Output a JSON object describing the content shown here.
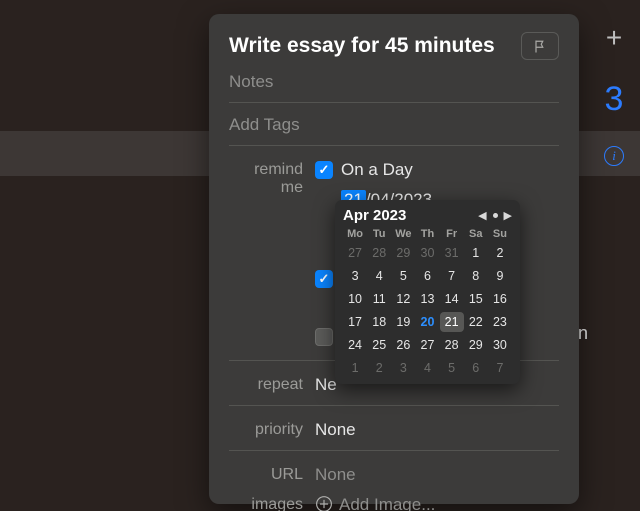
{
  "sidebar": {
    "big_number": "3",
    "background_item_suffix": "son"
  },
  "panel": {
    "title": "Write essay for 45 minutes",
    "notes_placeholder": "Notes",
    "tags_placeholder": "Add Tags",
    "labels": {
      "remind_me": "remind me",
      "repeat": "repeat",
      "priority": "priority",
      "url": "URL",
      "images": "images"
    },
    "remind": {
      "on_a_day_label": "On a Day",
      "date": {
        "selected_part": "21",
        "rest": "/04/2023"
      }
    },
    "repeat_value_visible": "Ne",
    "priority_value": "None",
    "url_value": "None",
    "add_image_label": "Add Image..."
  },
  "calendar": {
    "month_label": "Apr 2023",
    "dow": [
      "Mo",
      "Tu",
      "We",
      "Th",
      "Fr",
      "Sa",
      "Su"
    ],
    "today": 20,
    "selected": 21,
    "leading_out": [
      27,
      28,
      29,
      30,
      31
    ],
    "days": [
      1,
      2,
      3,
      4,
      5,
      6,
      7,
      8,
      9,
      10,
      11,
      12,
      13,
      14,
      15,
      16,
      17,
      18,
      19,
      20,
      21,
      22,
      23,
      24,
      25,
      26,
      27,
      28,
      29,
      30
    ],
    "trailing_out": [
      1,
      2,
      3,
      4,
      5,
      6,
      7
    ]
  }
}
